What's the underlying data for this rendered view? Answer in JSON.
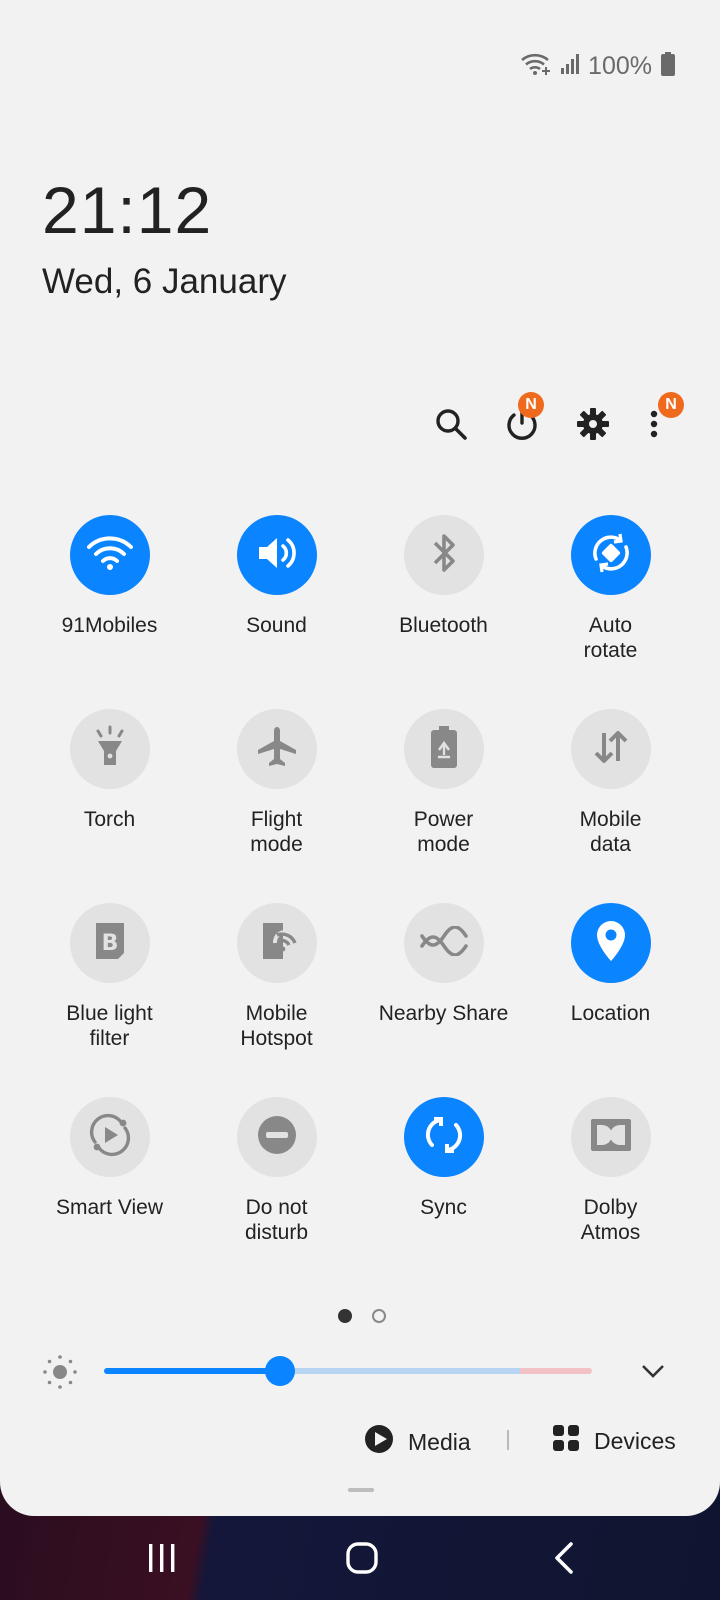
{
  "status_bar": {
    "battery_pct": "100%",
    "wifi_icon": "wifi-plus-icon",
    "signal_icon": "signal-icon",
    "battery_icon": "battery-icon"
  },
  "lock": {
    "time": "21:12",
    "date": "Wed, 6 January"
  },
  "actions": {
    "power_badge": "N",
    "menu_badge": "N"
  },
  "tiles": [
    {
      "label_lines": [
        "91Mobiles"
      ],
      "icon": "wifi-icon",
      "on": true
    },
    {
      "label_lines": [
        "Sound"
      ],
      "icon": "speaker-icon",
      "on": true
    },
    {
      "label_lines": [
        "Bluetooth"
      ],
      "icon": "bluetooth-icon",
      "on": false
    },
    {
      "label_lines": [
        "Auto",
        "rotate"
      ],
      "icon": "rotate-icon",
      "on": true
    },
    {
      "label_lines": [
        "Torch"
      ],
      "icon": "torch-icon",
      "on": false
    },
    {
      "label_lines": [
        "Flight",
        "mode"
      ],
      "icon": "airplane-icon",
      "on": false
    },
    {
      "label_lines": [
        "Power",
        "mode"
      ],
      "icon": "battery-eco-icon",
      "on": false
    },
    {
      "label_lines": [
        "Mobile",
        "data"
      ],
      "icon": "data-arrows-icon",
      "on": false
    },
    {
      "label_lines": [
        "Blue light",
        "filter"
      ],
      "icon": "blue-light-icon",
      "on": false
    },
    {
      "label_lines": [
        "Mobile",
        "Hotspot"
      ],
      "icon": "hotspot-icon",
      "on": false
    },
    {
      "label_lines": [
        "Nearby Share"
      ],
      "icon": "nearby-share-icon",
      "on": false
    },
    {
      "label_lines": [
        "Location"
      ],
      "icon": "location-pin-icon",
      "on": true
    },
    {
      "label_lines": [
        "Smart View"
      ],
      "icon": "smart-view-icon",
      "on": false
    },
    {
      "label_lines": [
        "Do not",
        "disturb"
      ],
      "icon": "do-not-disturb-icon",
      "on": false
    },
    {
      "label_lines": [
        "Sync"
      ],
      "icon": "sync-icon",
      "on": true
    },
    {
      "label_lines": [
        "Dolby",
        "Atmos"
      ],
      "icon": "dolby-icon",
      "on": false
    }
  ],
  "brightness": {
    "level": 0.36
  },
  "media": {
    "media_label": "Media",
    "devices_label": "Devices"
  },
  "colors": {
    "accent": "#0a84ff",
    "badge": "#f06a1e",
    "panel": "#f2f2f2"
  }
}
